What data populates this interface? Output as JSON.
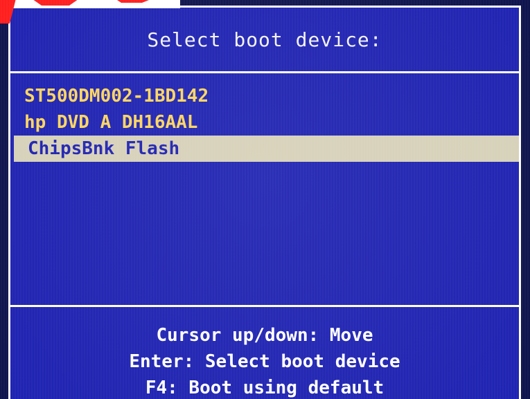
{
  "header": {
    "title": "Select boot device:"
  },
  "boot_devices": [
    {
      "label": "ST500DM002-1BD142",
      "selected": false
    },
    {
      "label": "hp DVD A DH16AAL",
      "selected": false
    },
    {
      "label": "ChipsBnk Flash",
      "selected": true
    }
  ],
  "footer": {
    "hint_move": "Cursor up/down: Move",
    "hint_select": "Enter: Select boot device",
    "hint_default": "F4: Boot using default"
  },
  "colors": {
    "background": "#1b1fb0",
    "text": "#ffffff",
    "device_text": "#ffd45a",
    "selection_bg": "#d6d0b8",
    "selection_text": "#1b1fb0"
  }
}
